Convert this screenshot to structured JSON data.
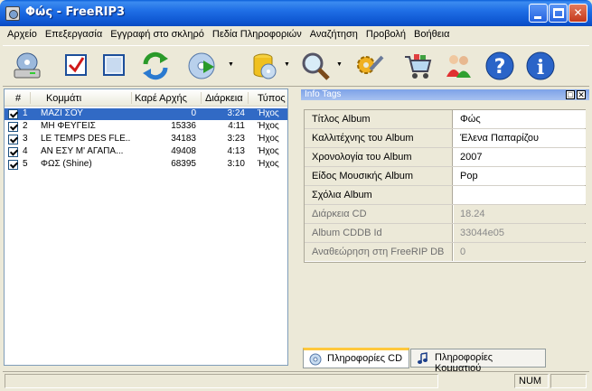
{
  "window": {
    "title": "Φώς - FreeRIP3"
  },
  "menu": [
    "Αρχείο",
    "Επεξεργασία",
    "Εγγραφή στο σκληρό",
    "Πεδία Πληροφοριών",
    "Αναζήτηση",
    "Προβολή",
    "Βοήθεια"
  ],
  "toolbar": {
    "buttons": [
      "drive-icon",
      "check-all-icon",
      "uncheck-all-icon",
      "refresh-icon",
      "cd-play-icon",
      "database-icon",
      "search-icon",
      "settings-icon",
      "shop-icon",
      "users-icon",
      "help-icon",
      "info-icon"
    ]
  },
  "tracklist": {
    "columns": [
      "#",
      "Κομμάτι",
      "Καρέ Αρχής",
      "Διάρκεια",
      "Τύπος"
    ],
    "rows": [
      {
        "num": "1",
        "title": "ΜΑΖΙ ΣΟΥ",
        "start": "0",
        "duration": "3:24",
        "type": "Ήχος",
        "selected": true
      },
      {
        "num": "2",
        "title": "ΜΗ ΦΕΥΓΕΙΣ",
        "start": "15336",
        "duration": "4:11",
        "type": "Ήχος",
        "selected": false
      },
      {
        "num": "3",
        "title": "LE TEMPS DES FLE...",
        "start": "34183",
        "duration": "3:23",
        "type": "Ήχος",
        "selected": false
      },
      {
        "num": "4",
        "title": "ΑΝ ΕΣΥ Μ' ΑΓΑΠΑ...",
        "start": "49408",
        "duration": "4:13",
        "type": "Ήχος",
        "selected": false
      },
      {
        "num": "5",
        "title": "ΦΩΣ (Shine)",
        "start": "68395",
        "duration": "3:10",
        "type": "Ήχος",
        "selected": false
      }
    ]
  },
  "info_panel": {
    "title": "Info Tags",
    "fields": [
      {
        "label": "Τίτλος Album",
        "value": "Φώς",
        "editable": true
      },
      {
        "label": "Καλλιτέχνης του Album",
        "value": "Έλενα Παπαρίζου",
        "editable": true
      },
      {
        "label": "Χρονολογία του Album",
        "value": "2007",
        "editable": true
      },
      {
        "label": "Είδος Μουσικής Album",
        "value": "Pop",
        "editable": true
      },
      {
        "label": "Σχόλια Album",
        "value": "",
        "editable": true
      },
      {
        "label": "Διάρκεια CD",
        "value": "18.24",
        "editable": false
      },
      {
        "label": "Album CDDB Id",
        "value": "33044e05",
        "editable": false
      },
      {
        "label": "Αναθεώρηση στη FreeRIP DB",
        "value": "0",
        "editable": false
      }
    ]
  },
  "tabs": [
    "Πληροφορίες CD",
    "Πληροφορίες Κομματιού"
  ],
  "status": {
    "numlock": "NUM"
  }
}
